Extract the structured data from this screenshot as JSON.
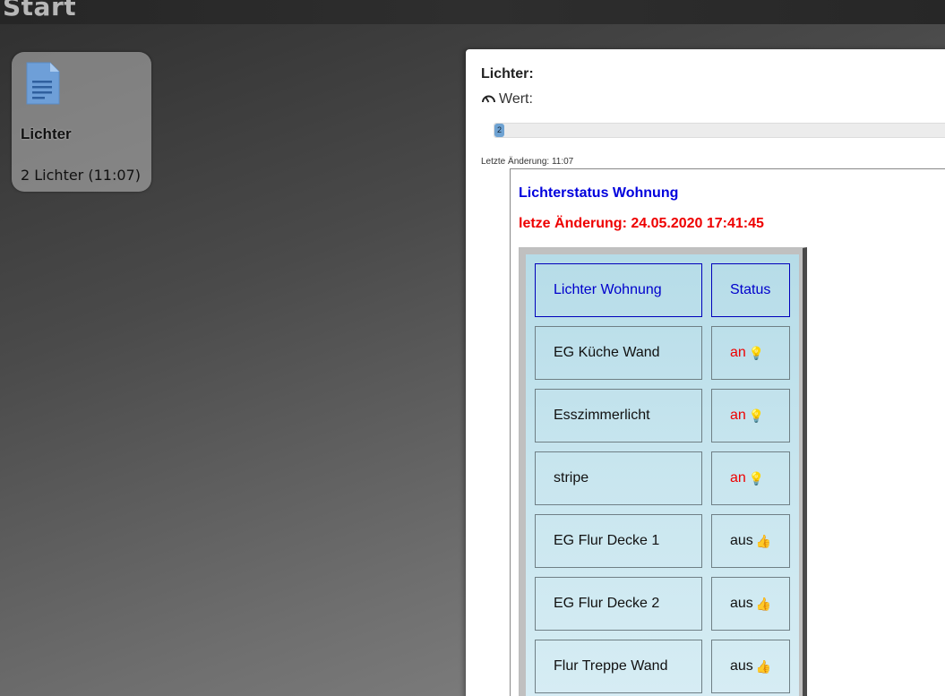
{
  "topbar": {
    "title": "Start"
  },
  "tile": {
    "icon": "document-icon",
    "title": "Lichter",
    "subtitle": "2 Lichter (11:07)"
  },
  "panel": {
    "title": "Lichter:",
    "wert_icon": "gauge-icon",
    "wert_label": "Wert:",
    "slider_value": "2",
    "last_change": "Letzte Änderung: 11:07",
    "status_title": "Lichterstatus Wohnung",
    "status_date": "letze Änderung: 24.05.2020 17:41:45",
    "colors": {
      "title_blue": "#0000dd",
      "date_red": "#ee0000",
      "status_on": "#ee0000"
    },
    "table": {
      "headers": [
        "Lichter Wohnung",
        "Status"
      ],
      "rows": [
        {
          "name": "EG Küche Wand",
          "status": "an",
          "icon": "lightbulb-icon"
        },
        {
          "name": "Esszimmerlicht",
          "status": "an",
          "icon": "lightbulb-icon"
        },
        {
          "name": "stripe",
          "status": "an",
          "icon": "lightbulb-icon"
        },
        {
          "name": "EG Flur Decke 1",
          "status": "aus",
          "icon": "thumbs-up-icon"
        },
        {
          "name": "EG Flur Decke 2",
          "status": "aus",
          "icon": "thumbs-up-icon"
        },
        {
          "name": "Flur Treppe Wand",
          "status": "aus",
          "icon": "thumbs-up-icon"
        }
      ]
    }
  }
}
